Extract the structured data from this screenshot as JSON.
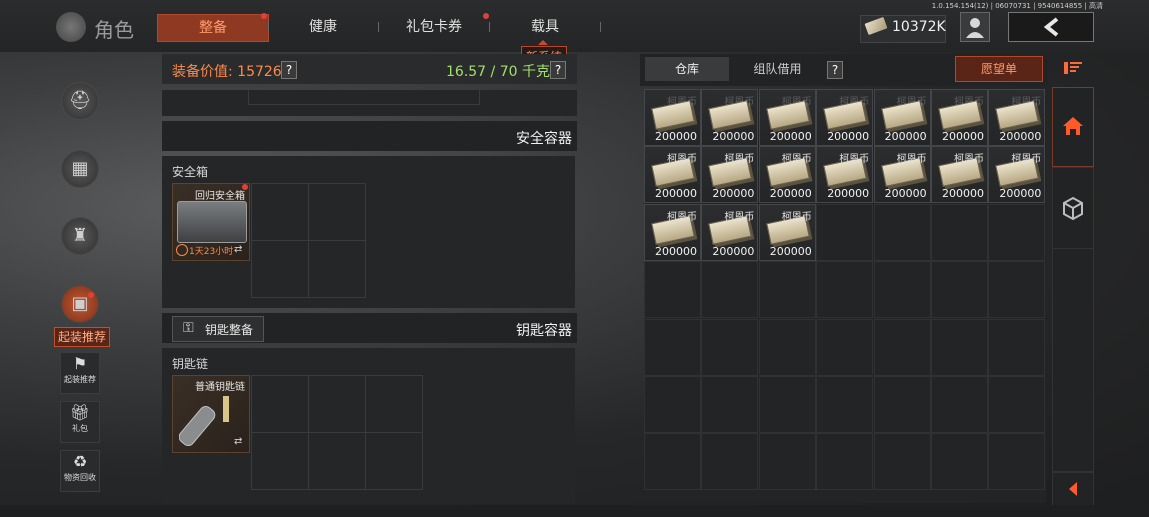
{
  "header": {
    "page_title": "角色",
    "tabs": [
      {
        "label": "整备",
        "active": true,
        "dot": true
      },
      {
        "label": "健康",
        "active": false,
        "dot": false
      },
      {
        "label": "礼包卡券",
        "active": false,
        "dot": true
      },
      {
        "label": "载具",
        "active": false,
        "dot": false
      }
    ],
    "new_system_badge": "新系统",
    "version": "1.0.154.154(12) | 06070731 | 9540614855 | 高清",
    "currency_value": "10372K",
    "currency_icon": "banknote-icon",
    "accent_color": "#ff8a5a"
  },
  "left_nav": {
    "recommend_label": "起装推荐",
    "buttons": [
      {
        "label": "起装推荐",
        "icon": "recommend-icon"
      },
      {
        "label": "礼包",
        "icon": "gift-icon"
      },
      {
        "label": "物资回收",
        "icon": "recycle-icon"
      }
    ]
  },
  "equipment": {
    "value_label": "装备价值: 15726",
    "weight_label": "16.57 / 70 千克",
    "help": "?",
    "secure_section_title": "安全容器",
    "secure_box_label": "安全箱",
    "secure_item_name": "回归安全箱",
    "secure_item_timer": "1天23小时",
    "key_button": "钥匙整备",
    "key_section_title": "钥匙容器",
    "keychain_label": "钥匙链",
    "key_item_name": "普通钥匙链"
  },
  "stash": {
    "tabs": [
      {
        "label": "仓库",
        "active": true
      },
      {
        "label": "组队借用",
        "active": false
      }
    ],
    "help": "?",
    "wishlist_button": "愿望单",
    "items": [
      {
        "name": "柯恩币",
        "qty": "200000"
      },
      {
        "name": "柯恩币",
        "qty": "200000"
      },
      {
        "name": "柯恩币",
        "qty": "200000"
      },
      {
        "name": "柯恩币",
        "qty": "200000"
      },
      {
        "name": "柯恩币",
        "qty": "200000"
      },
      {
        "name": "柯恩币",
        "qty": "200000"
      },
      {
        "name": "柯恩币",
        "qty": "200000"
      },
      {
        "name": "柯恩币",
        "qty": "200000"
      },
      {
        "name": "柯恩币",
        "qty": "200000"
      },
      {
        "name": "柯恩币",
        "qty": "200000"
      },
      {
        "name": "柯恩币",
        "qty": "200000"
      },
      {
        "name": "柯恩币",
        "qty": "200000"
      },
      {
        "name": "柯恩币",
        "qty": "200000"
      },
      {
        "name": "柯恩币",
        "qty": "200000"
      },
      {
        "name": "柯恩币",
        "qty": "200000"
      },
      {
        "name": "柯恩币",
        "qty": "200000"
      },
      {
        "name": "柯恩币",
        "qty": "200000"
      }
    ]
  }
}
